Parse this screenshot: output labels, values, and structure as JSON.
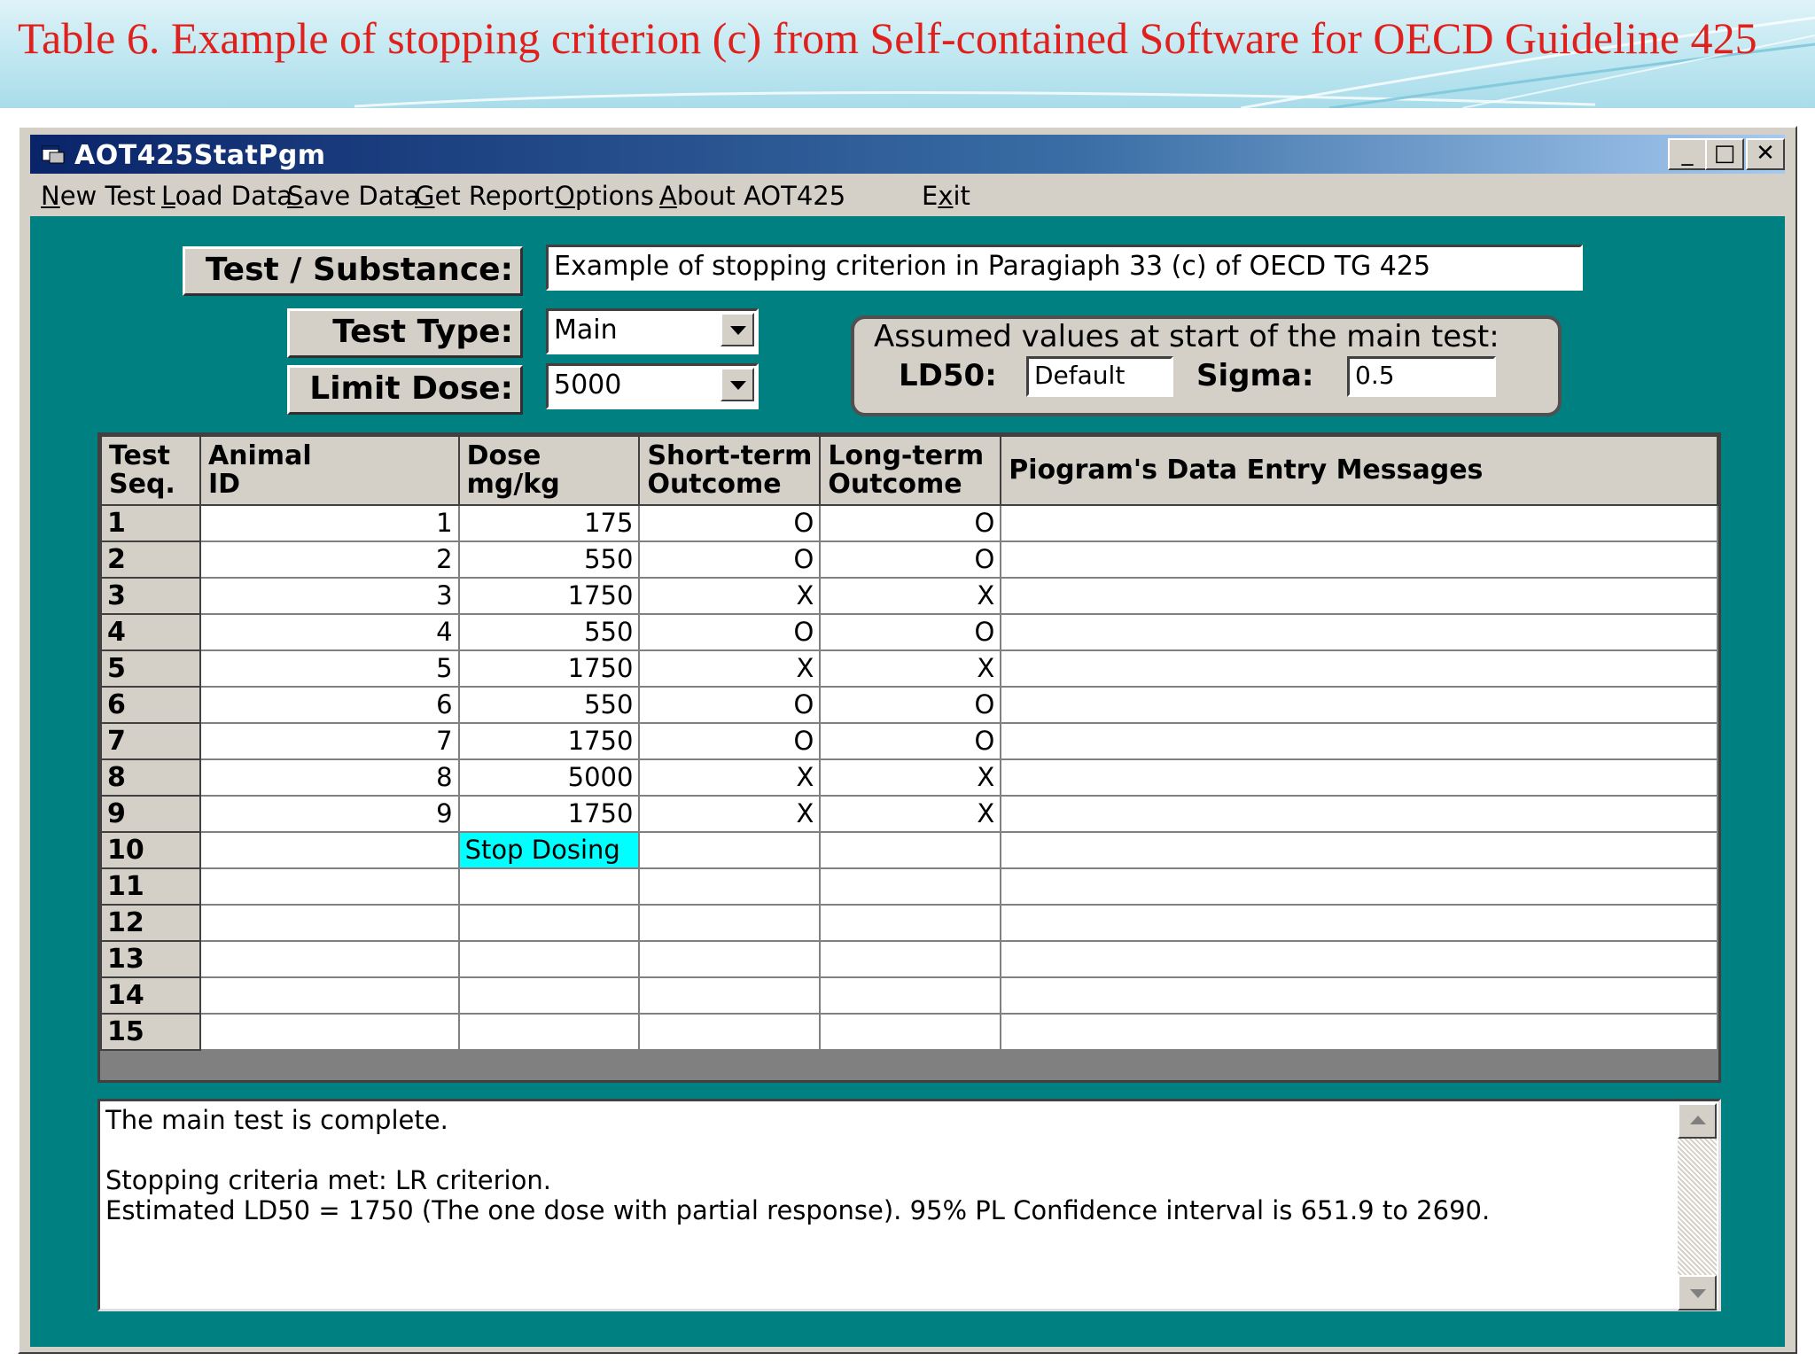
{
  "slide": {
    "title": "Table 6. Example of stopping criterion (c) from Self-contained Software for OECD Guideline 425"
  },
  "window": {
    "title": "AOT425StatPgm",
    "controls": {
      "minimize": "_",
      "maximize": "□",
      "close": "✕"
    }
  },
  "menu": {
    "items": [
      {
        "label": "New Test",
        "accel": "N",
        "rest": "ew Test"
      },
      {
        "label": "Load Data",
        "accel": "L",
        "rest": "oad Data"
      },
      {
        "label": "Save Data",
        "accel": "S",
        "rest": "ave Data"
      },
      {
        "label": "Get Report",
        "accel": "G",
        "rest": "et Report"
      },
      {
        "label": "Options",
        "accel": "O",
        "rest": "ptions"
      },
      {
        "label": "About AOT425",
        "accel": "A",
        "rest": "bout AOT425"
      },
      {
        "label": "Exit",
        "pre": "E",
        "accel": "x",
        "rest": "it"
      }
    ]
  },
  "form": {
    "test_substance_label": "Test / Substance:",
    "test_substance_value": "Example of stopping criterion in Paragiaph 33 (c) of OECD TG 425",
    "test_type_label": "Test Type:",
    "test_type_value": "Main",
    "limit_dose_label": "Limit Dose:",
    "limit_dose_value": "5000",
    "assumed_title": "Assumed values at start of the main test:",
    "ld50_label": "LD50:",
    "ld50_value": "Default",
    "sigma_label": "Sigma:",
    "sigma_value": "0.5"
  },
  "grid": {
    "headers": {
      "seq": [
        "Test",
        "Seq."
      ],
      "animal": [
        "Animal",
        "ID"
      ],
      "dose": [
        "Dose",
        "mg/kg"
      ],
      "short": [
        "Short-term",
        "Outcome"
      ],
      "long": [
        "Long-term",
        "Outcome"
      ],
      "msg": "Piogram's Data Entry Messages"
    },
    "rows": [
      {
        "seq": "1",
        "animal": "1",
        "dose": "175",
        "short": "O",
        "long": "O",
        "msg": ""
      },
      {
        "seq": "2",
        "animal": "2",
        "dose": "550",
        "short": "O",
        "long": "O",
        "msg": ""
      },
      {
        "seq": "3",
        "animal": "3",
        "dose": "1750",
        "short": "X",
        "long": "X",
        "msg": ""
      },
      {
        "seq": "4",
        "animal": "4",
        "dose": "550",
        "short": "O",
        "long": "O",
        "msg": ""
      },
      {
        "seq": "5",
        "animal": "5",
        "dose": "1750",
        "short": "X",
        "long": "X",
        "msg": ""
      },
      {
        "seq": "6",
        "animal": "6",
        "dose": "550",
        "short": "O",
        "long": "O",
        "msg": ""
      },
      {
        "seq": "7",
        "animal": "7",
        "dose": "1750",
        "short": "O",
        "long": "O",
        "msg": ""
      },
      {
        "seq": "8",
        "animal": "8",
        "dose": "5000",
        "short": "X",
        "long": "X",
        "msg": ""
      },
      {
        "seq": "9",
        "animal": "9",
        "dose": "1750",
        "short": "X",
        "long": "X",
        "msg": ""
      },
      {
        "seq": "10",
        "animal": "",
        "dose": "Stop Dosing",
        "short": "",
        "long": "",
        "msg": "",
        "stop": true
      },
      {
        "seq": "11",
        "animal": "",
        "dose": "",
        "short": "",
        "long": "",
        "msg": ""
      },
      {
        "seq": "12",
        "animal": "",
        "dose": "",
        "short": "",
        "long": "",
        "msg": ""
      },
      {
        "seq": "13",
        "animal": "",
        "dose": "",
        "short": "",
        "long": "",
        "msg": ""
      },
      {
        "seq": "14",
        "animal": "",
        "dose": "",
        "short": "",
        "long": "",
        "msg": ""
      },
      {
        "seq": "15",
        "animal": "",
        "dose": "",
        "short": "",
        "long": "",
        "msg": ""
      }
    ]
  },
  "messages": {
    "line1": "The main test is complete.",
    "line2": "",
    "line3": "Stopping criteria met: LR criterion.",
    "line4": "Estimated LD50 = 1750 (The one dose with partial response). 95% PL Confidence interval is 651.9 to 2690."
  },
  "colors": {
    "client_bg": "#008080",
    "titlebar": "#0a246a",
    "stop_highlight": "#00ffff",
    "slide_title": "#e0201c"
  }
}
